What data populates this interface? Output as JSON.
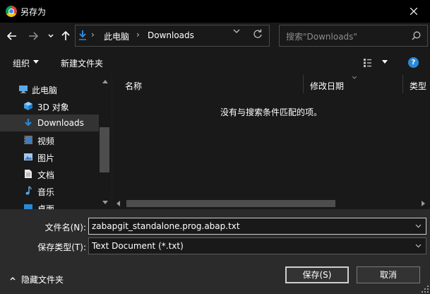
{
  "window": {
    "title": "另存为"
  },
  "address": {
    "segments": [
      "此电脑",
      "Downloads"
    ]
  },
  "search": {
    "placeholder": "搜索\"Downloads\""
  },
  "toolbar": {
    "organize": "组织",
    "new_folder": "新建文件夹",
    "help": "?"
  },
  "nav_pane": {
    "items": [
      {
        "label": "此电脑",
        "icon": "computer-icon"
      },
      {
        "label": "3D 对象",
        "icon": "cube-icon"
      },
      {
        "label": "Downloads",
        "icon": "download-icon",
        "selected": true
      },
      {
        "label": "视频",
        "icon": "video-icon"
      },
      {
        "label": "图片",
        "icon": "picture-icon"
      },
      {
        "label": "文档",
        "icon": "document-icon"
      },
      {
        "label": "音乐",
        "icon": "music-icon"
      },
      {
        "label": "桌面",
        "icon": "desktop-icon"
      }
    ]
  },
  "file_list": {
    "columns": [
      "名称",
      "修改日期",
      "类型"
    ],
    "empty_message": "没有与搜索条件匹配的项。"
  },
  "form": {
    "filename_label": "文件名(N):",
    "filename_value": "zabapgit_standalone.prog.abap.txt",
    "filetype_label": "保存类型(T):",
    "filetype_value": "Text Document (*.txt)",
    "hide_folders": "隐藏文件夹",
    "save": "保存(S)",
    "cancel": "取消"
  },
  "colors": {
    "titlebar": "#000000",
    "panel": "#191919",
    "form": "#2b2b2b",
    "accent": "#2b88d8"
  }
}
